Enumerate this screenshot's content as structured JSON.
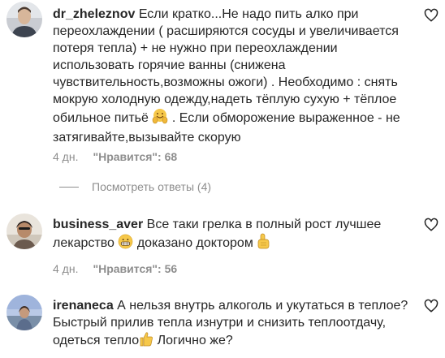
{
  "comments": [
    {
      "username": "dr_zheleznov",
      "lines": [
        "Если кратко...Не надо пить алко при",
        "переохлаждении ( расширяются сосуды и увеличивается",
        "потеря тепла) + не нужно при переохлаждении",
        "использовать горячие ванны (снижена",
        "чувствительность,возможны ожоги) . Необходимо : снять",
        "мокрую холодную одежду,надеть тёплую сухую + тёплое",
        "обильное питьё",
        " . Если обморожение выраженное - не",
        "затягивайте,вызывайте скорую"
      ],
      "time": "4 дн.",
      "likes": "\"Нравится\": 68"
    },
    {
      "username": "business_aver",
      "lines": [
        "Все таки грелка в полный рост лучшее",
        "лекарство",
        " доказано доктором"
      ],
      "time": "4 дн.",
      "likes": "\"Нравится\": 56"
    },
    {
      "username": "irenaneca",
      "lines": [
        "А нельзя внутрь алкоголь и укутаться в теплое?",
        "Быстрый прилив тепла изнутри и снизить теплоотдачу,",
        "одеться тепло",
        " Логично же?"
      ]
    }
  ],
  "view_replies": "Посмотреть ответы (4)",
  "icons": {
    "like": "heart-outline-icon",
    "emoji_1": "hugging-face-emoji",
    "emoji_2": "grinning-face-emoji",
    "emoji_3": "backhand-index-pointing-left-emoji",
    "emoji_4": "thumbs-up-emoji"
  },
  "colors": {
    "text": "#262626",
    "secondary": "#8e8e8e",
    "emoji_yellow": "#f6c84a"
  }
}
